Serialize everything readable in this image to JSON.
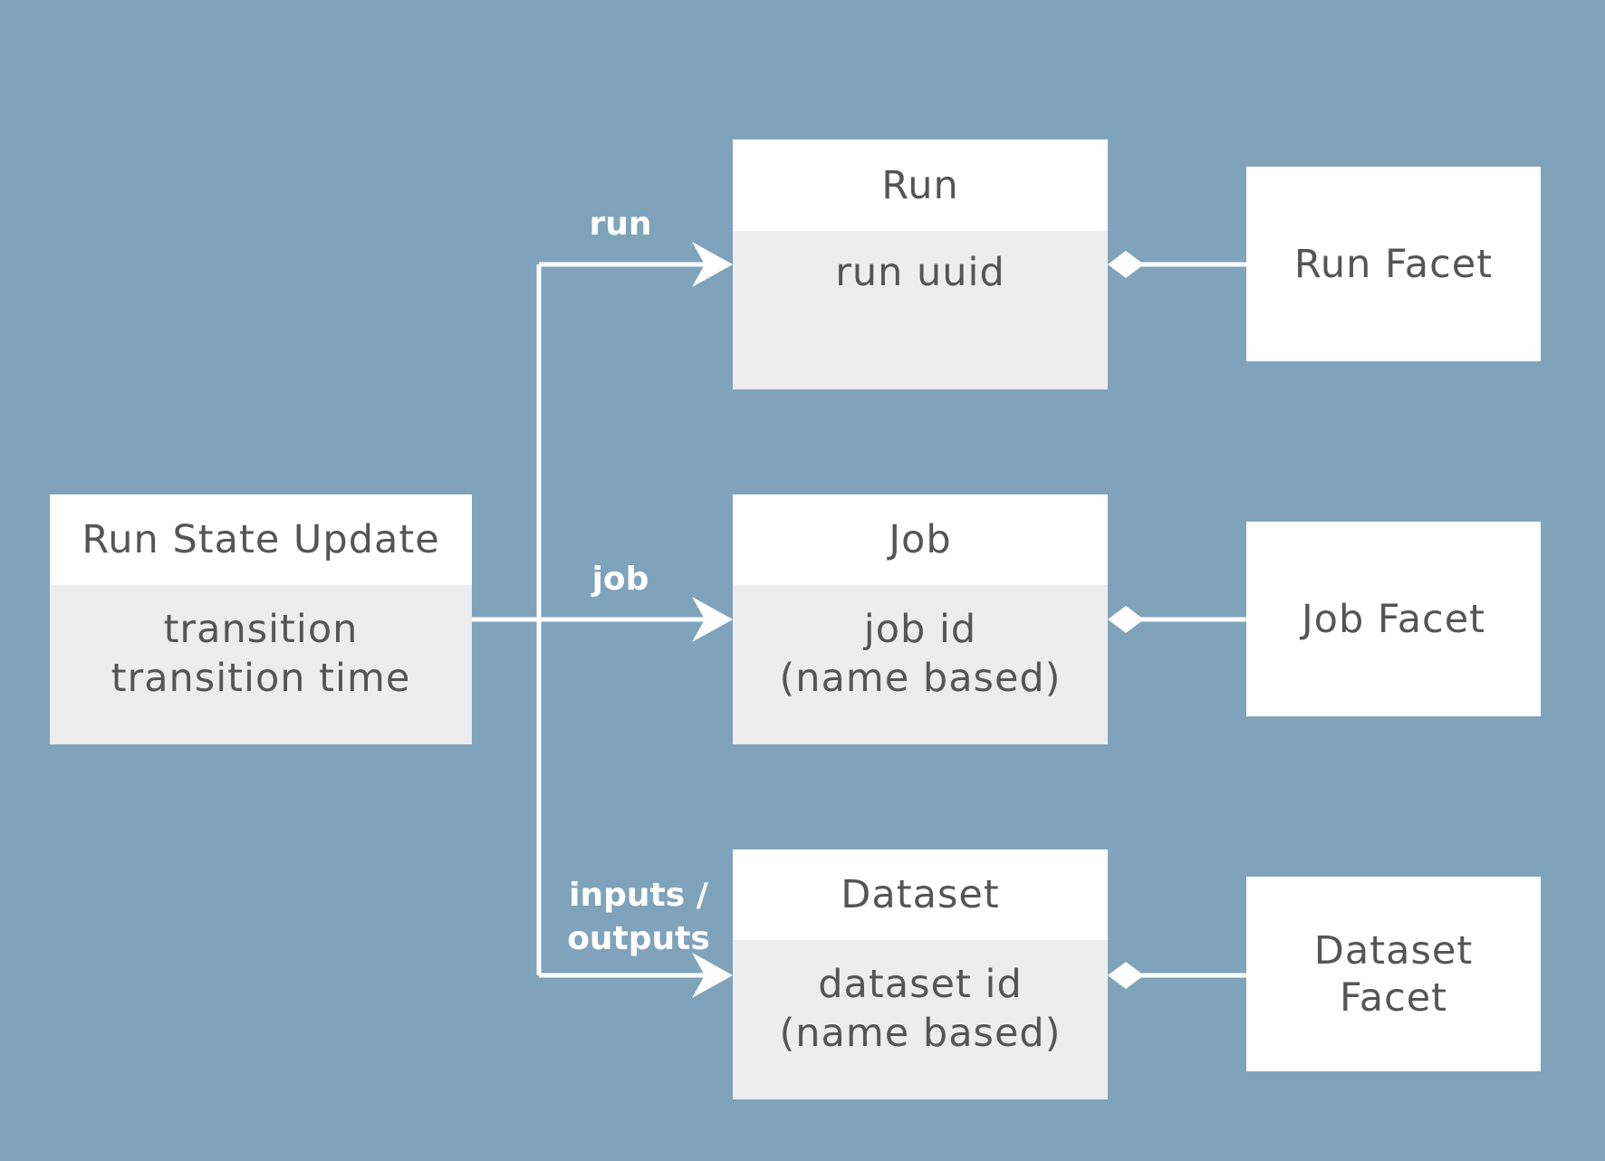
{
  "colors": {
    "background": "#7fa3bb",
    "header": "#ffffff",
    "body": "#ededed",
    "text": "#555555",
    "connector": "#ffffff"
  },
  "source": {
    "title": "Run State Update",
    "fields": [
      "transition",
      "transition time"
    ]
  },
  "entities": [
    {
      "title": "Run",
      "fields": [
        "run uuid"
      ],
      "facet": "Run Facet",
      "edge_label": "run"
    },
    {
      "title": "Job",
      "fields": [
        "job id",
        "(name based)"
      ],
      "facet": "Job Facet",
      "edge_label": "job"
    },
    {
      "title": "Dataset",
      "fields": [
        "dataset id",
        "(name based)"
      ],
      "facet": "Dataset Facet",
      "edge_label": "inputs / outputs"
    }
  ],
  "labels": {
    "run": "run",
    "job": "job",
    "inputs": "inputs /",
    "outputs": "outputs",
    "dataset_facet_1": "Dataset",
    "dataset_facet_2": "Facet"
  }
}
